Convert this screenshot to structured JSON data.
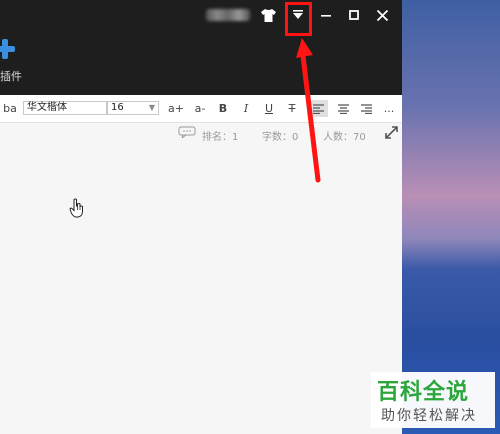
{
  "titlebar": {
    "skin_icon": "tshirt-icon",
    "menu_icon": "triangle-down-icon",
    "minimize_icon": "minimize-icon",
    "maximize_icon": "maximize-icon",
    "close_icon": "close-icon"
  },
  "sidebar": {
    "plugin_label": "插件"
  },
  "toolbar": {
    "format_label": "ba",
    "font_name": "华文楷体",
    "font_size": "16",
    "grow_label": "a+",
    "shrink_label": "a-",
    "bold_label": "B",
    "italic_label": "I",
    "underline_label": "U",
    "strike_label": "T",
    "more_label": "..."
  },
  "status": {
    "rank": "排名：1",
    "chars": "字数：0",
    "people": "人数：70"
  },
  "watermark": {
    "title": "百科全说",
    "subtitle": "助你轻松解决"
  },
  "colors": {
    "highlight": "#ff1414",
    "accent_blue": "#3b8fe0",
    "brand_green": "#2aa63a"
  }
}
